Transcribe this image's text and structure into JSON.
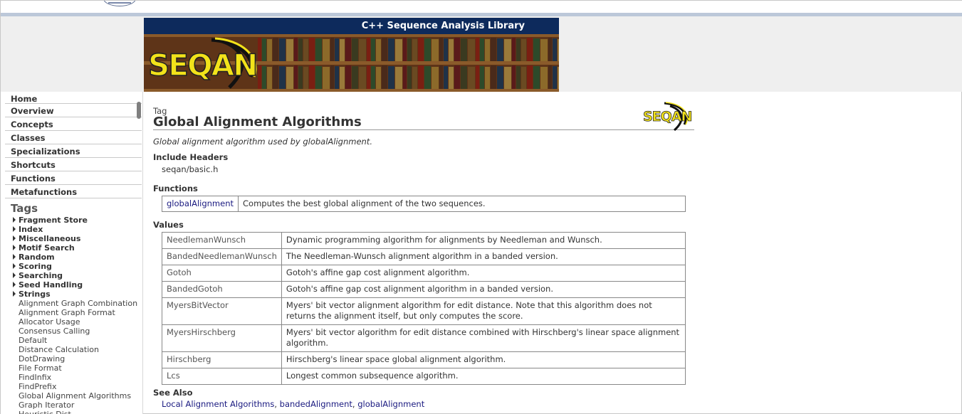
{
  "banner": {
    "title": "C++ Sequence Analysis Library",
    "logo_text": "SEQAN"
  },
  "small_logo_text": "SEQAN",
  "sidebar": {
    "nav": [
      "Home",
      "Overview",
      "Concepts",
      "Classes",
      "Specializations",
      "Shortcuts",
      "Functions",
      "Metafunctions"
    ],
    "tags_heading": "Tags",
    "groups": [
      "Fragment Store",
      "Index",
      "Miscellaneous",
      "Motif Search",
      "Random",
      "Scoring",
      "Searching",
      "Seed Handling",
      "Strings"
    ],
    "leaves": [
      "Alignment Graph Combination",
      "Alignment Graph Format",
      "Allocator Usage",
      "Consensus Calling",
      "Default",
      "Distance Calculation",
      "DotDrawing",
      "File Format",
      "FindInfix",
      "FindPrefix",
      "Global Alignment Algorithms",
      "Graph Iterator",
      "Heuristic Dist..."
    ]
  },
  "page": {
    "kind": "Tag",
    "title": "Global Alignment Algorithms",
    "summary": "Global alignment algorithm used by globalAlignment.",
    "include_headers_label": "Include Headers",
    "include_header": "seqan/basic.h",
    "functions_label": "Functions",
    "functions": [
      {
        "name": "globalAlignment",
        "desc": "Computes the best global alignment of the two sequences."
      }
    ],
    "values_label": "Values",
    "values": [
      {
        "name": "NeedlemanWunsch",
        "desc": "Dynamic programming algorithm for alignments by Needleman and Wunsch."
      },
      {
        "name": "BandedNeedlemanWunsch",
        "desc": "The Needleman-Wunsch alignment algorithm in a banded version."
      },
      {
        "name": "Gotoh",
        "desc": "Gotoh's affine gap cost alignment algorithm."
      },
      {
        "name": "BandedGotoh",
        "desc": "Gotoh's affine gap cost alignment algorithm in a banded version."
      },
      {
        "name": "MyersBitVector",
        "desc": "Myers' bit vector alignment algorithm for edit distance. Note that this algorithm does not returns the alignment itself, but only computes the score."
      },
      {
        "name": "MyersHirschberg",
        "desc": "Myers' bit vector algorithm for edit distance combined with Hirschberg's linear space alignment algorithm."
      },
      {
        "name": "Hirschberg",
        "desc": "Hirschberg's linear space global alignment algorithm."
      },
      {
        "name": "Lcs",
        "desc": "Longest common subsequence algorithm."
      }
    ],
    "see_also_label": "See Also",
    "see_also": [
      "Local Alignment Algorithms",
      "bandedAlignment",
      "globalAlignment"
    ],
    "see_also_sep": ", "
  },
  "colors": {
    "banner_bar": "#0d2a5c",
    "logo_yellow": "#f2e21a",
    "link": "#1a1a80",
    "header_band": "#efefef"
  }
}
